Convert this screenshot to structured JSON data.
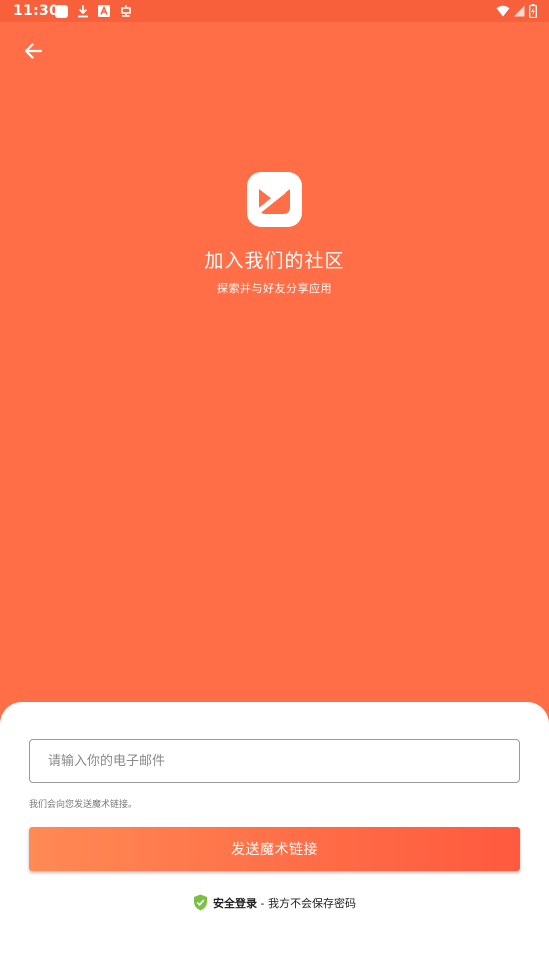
{
  "status_bar": {
    "time": "11:30",
    "left_icons": [
      "app-square-icon",
      "download-icon",
      "a-box-icon",
      "bug-icon"
    ],
    "right_icons": [
      "wifi-icon",
      "signal-icon",
      "battery-charging-icon"
    ]
  },
  "header": {
    "back_icon": "arrow-left-icon"
  },
  "hero": {
    "logo_icon": "app-logo-icon",
    "title": "加入我们的社区",
    "subtitle": "探索并与好友分享应用"
  },
  "form": {
    "email_placeholder": "请输入你的电子邮件",
    "email_value": "",
    "helper_text": "我们会向您发送魔术链接。",
    "send_button_label": "发送魔术链接"
  },
  "footer": {
    "secure_icon": "shield-check-icon",
    "secure_label": "安全登录",
    "secure_note": " - 我方不会保存密码"
  },
  "colors": {
    "accent": "#FF6E47",
    "status_bar": "#F85F3B",
    "button_gradient_start": "#FF8A55",
    "button_gradient_end": "#FF5A3E",
    "shield": "#7BC043"
  }
}
